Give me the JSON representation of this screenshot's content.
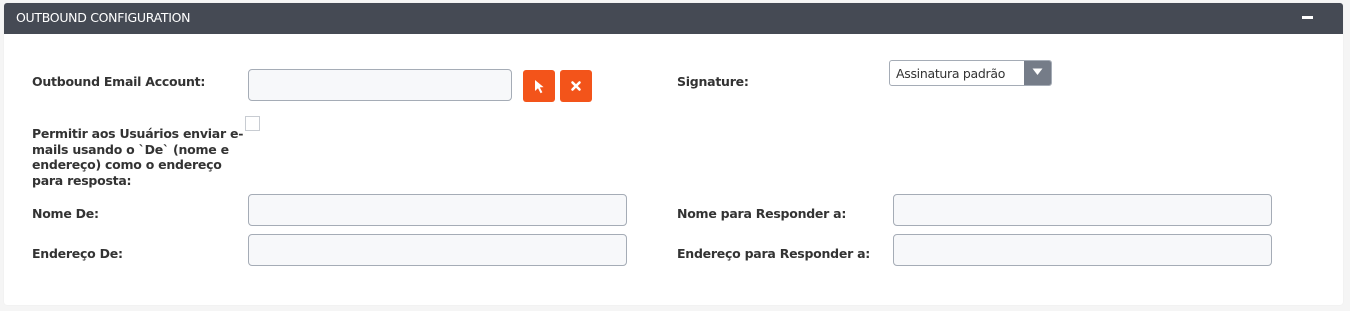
{
  "panel": {
    "title": "OUTBOUND CONFIGURATION"
  },
  "outbound_email_account": {
    "label": "Outbound Email Account:",
    "value": ""
  },
  "signature": {
    "label": "Signature:",
    "selected": "Assinatura padrão"
  },
  "allow_users": {
    "label": "Permitir aos Usuários enviar e-mails usando o `De` (nome e endereço) como o endereço para resposta:",
    "checked": false
  },
  "from_name": {
    "label": "Nome De:",
    "value": ""
  },
  "reply_to_name": {
    "label": "Nome para Responder a:",
    "value": ""
  },
  "from_address": {
    "label": "Endereço De:",
    "value": ""
  },
  "reply_to_address": {
    "label": "Endereço para Responder a:",
    "value": ""
  },
  "icons": {
    "select": "cursor-arrow-icon",
    "clear": "x-icon",
    "collapse": "minus-icon",
    "dropdown": "caret-down-icon"
  },
  "colors": {
    "header": "#454a54",
    "accent": "#f3541a",
    "select_arrow": "#757c88"
  }
}
